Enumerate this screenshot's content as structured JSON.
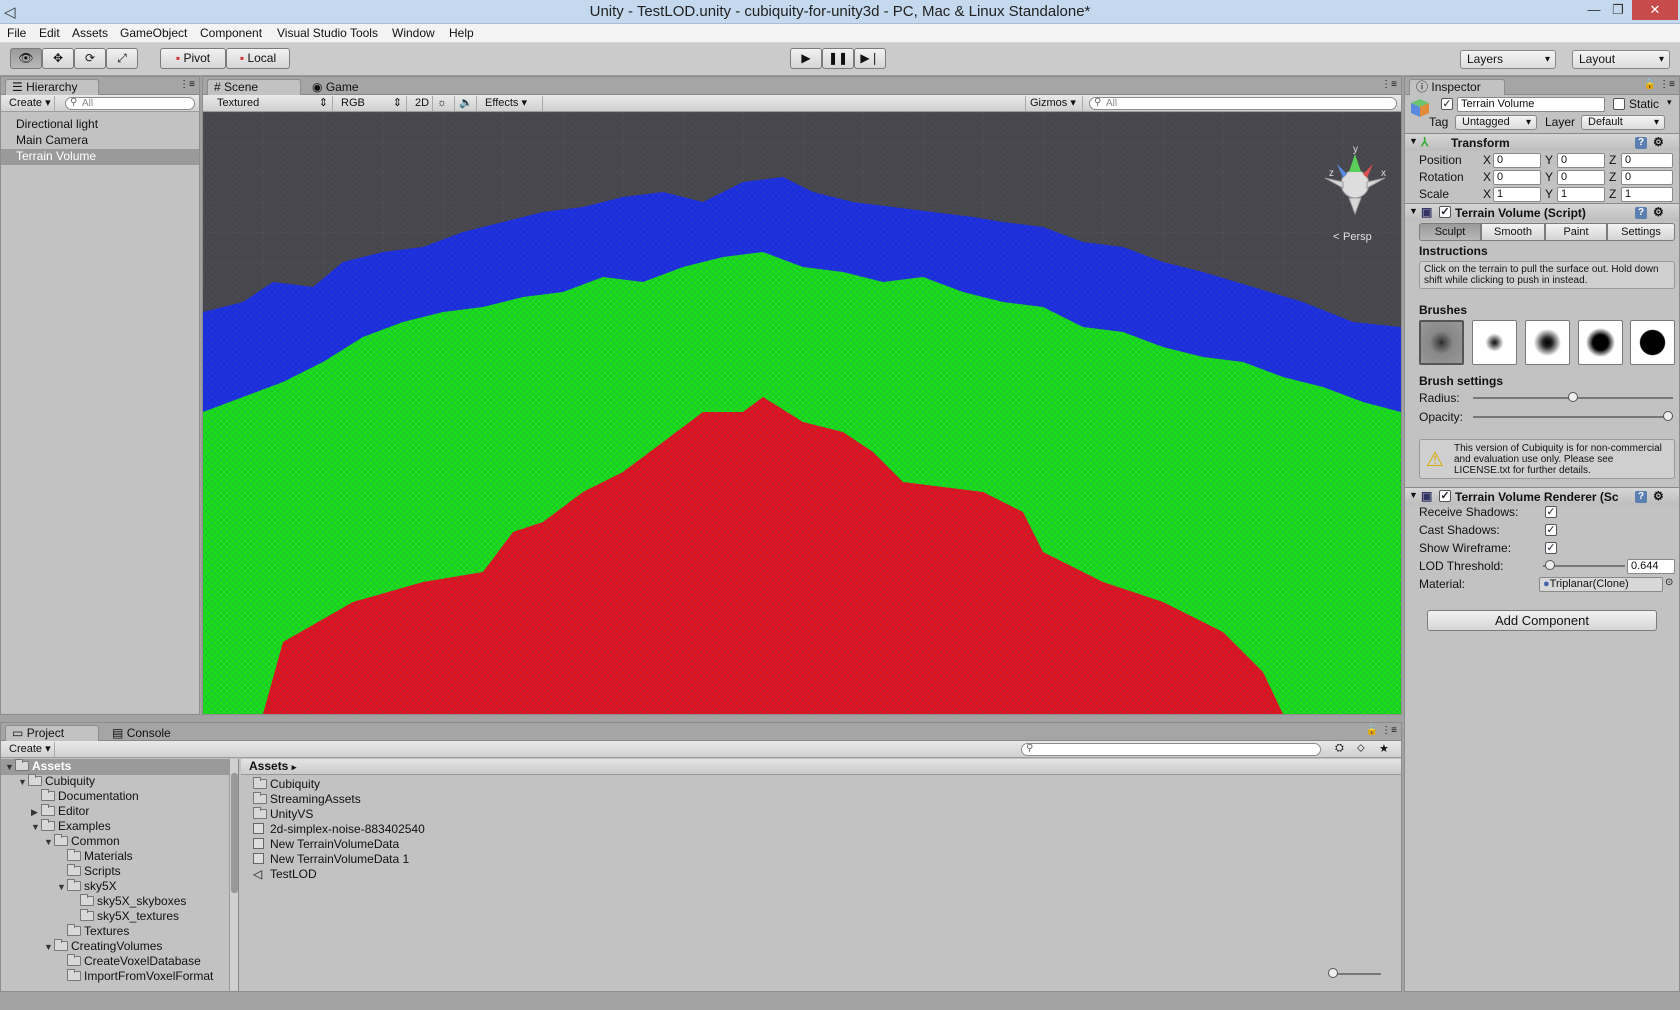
{
  "window": {
    "title": "Unity - TestLOD.unity - cubiquity-for-unity3d - PC, Mac & Linux Standalone*",
    "minimize": "—",
    "maximize": "❐",
    "close": "✕"
  },
  "menu": [
    "File",
    "Edit",
    "Assets",
    "GameObject",
    "Component",
    "Visual Studio Tools",
    "Window",
    "Help"
  ],
  "toolbar": {
    "pivot": "Pivot",
    "local": "Local",
    "play": "▶",
    "pause": "❚❚",
    "step": "▶❘",
    "layers": "Layers",
    "layout": "Layout"
  },
  "hierarchy": {
    "tab": "Hierarchy",
    "create": "Create",
    "search_placeholder": "All",
    "items": [
      "Directional light",
      "Main Camera",
      "Terrain Volume"
    ],
    "selected": "Terrain Volume"
  },
  "scene": {
    "tab_scene": "Scene",
    "tab_game": "Game",
    "draw_mode": "Textured",
    "render_mode": "RGB",
    "mode_2d": "2D",
    "effects": "Effects",
    "gizmos": "Gizmos",
    "search_placeholder": "All",
    "persp_label": "Persp",
    "gizmo_x": "x",
    "gizmo_y": "y",
    "gizmo_z": "z",
    "colors": {
      "sky": "#474747",
      "blue": "#1a2ee0",
      "green": "#18e018",
      "red": "#e0121c"
    }
  },
  "inspector": {
    "tab": "Inspector",
    "object_name": "Terrain Volume",
    "static_label": "Static",
    "tag_label": "Tag",
    "tag_value": "Untagged",
    "layer_label": "Layer",
    "layer_value": "Default",
    "transform": {
      "title": "Transform",
      "rows": [
        {
          "label": "Position",
          "x": "0",
          "y": "0",
          "z": "0"
        },
        {
          "label": "Rotation",
          "x": "0",
          "y": "0",
          "z": "0"
        },
        {
          "label": "Scale",
          "x": "1",
          "y": "1",
          "z": "1"
        }
      ],
      "axis_x": "X",
      "axis_y": "Y",
      "axis_z": "Z"
    },
    "script": {
      "title": "Terrain Volume (Script)",
      "tabs": [
        "Sculpt",
        "Smooth",
        "Paint",
        "Settings"
      ],
      "instructions_title": "Instructions",
      "instructions": "Click on the terrain to pull the surface out. Hold down shift while clicking to push in instead.",
      "brushes_title": "Brushes",
      "brush_settings_title": "Brush settings",
      "radius_label": "Radius:",
      "radius_value": 0.5,
      "opacity_label": "Opacity:",
      "opacity_value": 1.0,
      "warning": "This version of Cubiquity is for non-commercial and evaluation use only. Please see LICENSE.txt for further details."
    },
    "renderer": {
      "title": "Terrain Volume Renderer (Sc",
      "receive_shadows": "Receive Shadows:",
      "cast_shadows": "Cast Shadows:",
      "show_wireframe": "Show Wireframe:",
      "lod_threshold": "LOD Threshold:",
      "lod_value": "0.644",
      "material_label": "Material:",
      "material_value": "Triplanar(Clone)"
    },
    "add_component": "Add Component"
  },
  "project": {
    "tab_project": "Project",
    "tab_console": "Console",
    "create": "Create",
    "tree": [
      {
        "label": "Assets",
        "depth": 0,
        "arrow": "▼",
        "selected": true
      },
      {
        "label": "Cubiquity",
        "depth": 1,
        "arrow": "▼"
      },
      {
        "label": "Documentation",
        "depth": 2,
        "arrow": ""
      },
      {
        "label": "Editor",
        "depth": 2,
        "arrow": "▶"
      },
      {
        "label": "Examples",
        "depth": 2,
        "arrow": "▼"
      },
      {
        "label": "Common",
        "depth": 3,
        "arrow": "▼"
      },
      {
        "label": "Materials",
        "depth": 4,
        "arrow": ""
      },
      {
        "label": "Scripts",
        "depth": 4,
        "arrow": ""
      },
      {
        "label": "sky5X",
        "depth": 4,
        "arrow": "▼"
      },
      {
        "label": "sky5X_skyboxes",
        "depth": 5,
        "arrow": ""
      },
      {
        "label": "sky5X_textures",
        "depth": 5,
        "arrow": ""
      },
      {
        "label": "Textures",
        "depth": 4,
        "arrow": ""
      },
      {
        "label": "CreatingVolumes",
        "depth": 3,
        "arrow": "▼"
      },
      {
        "label": "CreateVoxelDatabase",
        "depth": 4,
        "arrow": ""
      },
      {
        "label": "ImportFromVoxelFormat",
        "depth": 4,
        "arrow": ""
      }
    ],
    "breadcrumb": "Assets",
    "assets": [
      {
        "label": "Cubiquity",
        "icon": "folder-icon"
      },
      {
        "label": "StreamingAssets",
        "icon": "folder-icon"
      },
      {
        "label": "UnityVS",
        "icon": "folder-icon"
      },
      {
        "label": "2d-simplex-noise-883402540",
        "icon": "asset-icon"
      },
      {
        "label": "New TerrainVolumeData",
        "icon": "asset-icon"
      },
      {
        "label": "New TerrainVolumeData 1",
        "icon": "asset-icon"
      },
      {
        "label": "TestLOD",
        "icon": "unity-scene-icon"
      }
    ]
  }
}
